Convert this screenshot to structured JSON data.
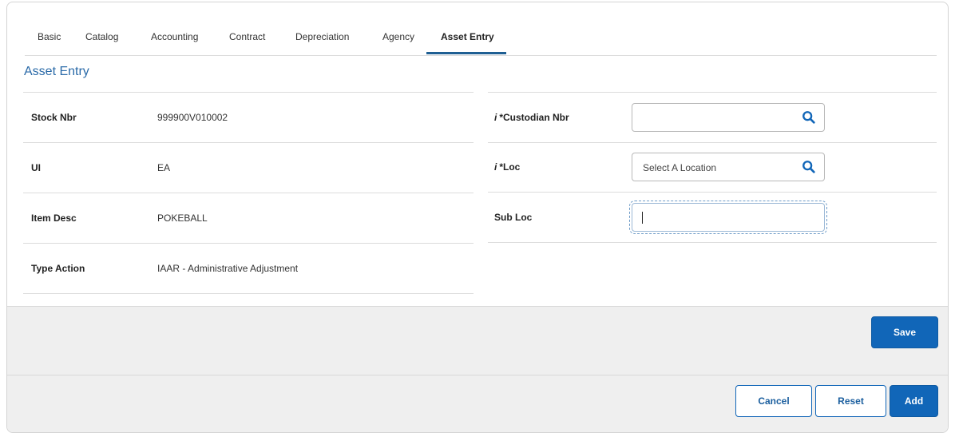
{
  "tabs": [
    {
      "label": "Basic",
      "active": false
    },
    {
      "label": "Catalog",
      "active": false
    },
    {
      "label": "Accounting",
      "active": false
    },
    {
      "label": "Contract",
      "active": false
    },
    {
      "label": "Depreciation",
      "active": false
    },
    {
      "label": "Agency",
      "active": false
    },
    {
      "label": "Asset Entry",
      "active": true
    }
  ],
  "section": {
    "title": "Asset Entry"
  },
  "left_fields": [
    {
      "label": "Stock Nbr",
      "value": "999900V010002"
    },
    {
      "label": "UI",
      "value": "EA"
    },
    {
      "label": "Item Desc",
      "value": "POKEBALL"
    },
    {
      "label": "Type Action",
      "value": "IAAR - Administrative Adjustment"
    }
  ],
  "right_fields": [
    {
      "info": "i",
      "label": "*Custodian Nbr",
      "value": "",
      "placeholder": "",
      "icon": "search-icon"
    },
    {
      "info": "i",
      "label": "*Loc",
      "value": "",
      "placeholder": "Select A Location",
      "icon": "search-icon"
    },
    {
      "info": "",
      "label": "Sub Loc",
      "value": "",
      "placeholder": "",
      "focused": true
    }
  ],
  "buttons": {
    "save": "Save",
    "cancel": "Cancel",
    "reset": "Reset",
    "add": "Add"
  },
  "colors": {
    "accent": "#1166b8",
    "section_title": "#2a6aa8",
    "tab_underline": "#1f5f93"
  }
}
